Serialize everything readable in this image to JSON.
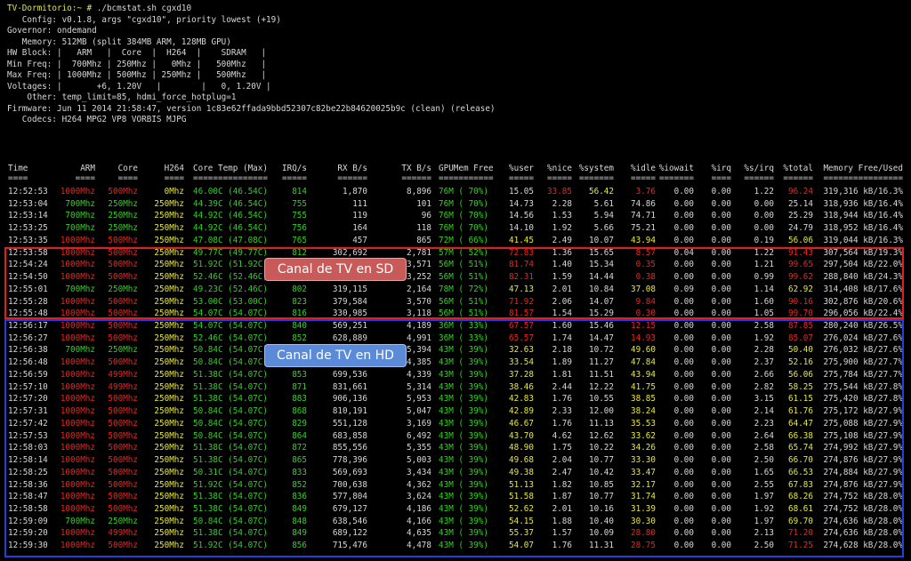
{
  "header": {
    "prompt": "TV-Dormitorio:~ #",
    "command": "./bcmstat.sh cgxd10",
    "lines": [
      "   Config: v0.1.8, args \"cgxd10\", priority lowest (+19)",
      "Governor: ondemand",
      "   Memory: 512MB (split 384MB ARM, 128MB GPU)",
      "HW Block: |   ARM   |  Core  |  H264  |    SDRAM   |",
      "Min Freq: |  700Mhz | 250Mhz |   0Mhz |   500Mhz   |",
      "Max Freq: | 1000Mhz | 500Mhz | 250Mhz |   500Mhz   |",
      "Voltages: |       +6, 1.20V   |        |   0, 1.20V |",
      "    Other: temp_limit=85, hdmi_force_hotplug=1",
      "Firmware: Jun 11 2014 21:58:47, version 1c83e62ffada9bbd52307c82be22b84620025b9c (clean) (release)",
      "   Codecs: H264 MPG2 VP8 VORBIS MJPG"
    ]
  },
  "table": {
    "columns": [
      "Time",
      "ARM",
      "Core",
      "H264",
      "Core Temp (Max)",
      "IRQ/s",
      "RX B/s",
      "TX B/s",
      "GPUMem Free",
      "%user",
      "%nice",
      "%system",
      "%idle",
      "%iowait",
      "%irq",
      "%s/irq",
      "%total",
      "Memory Free/Used"
    ],
    "rows": [
      [
        "12:52:53",
        "1000Mhz",
        "500Mhz",
        "0Mhz",
        "46.00C (46.54C)",
        "814",
        "1,870",
        "8,896",
        "76M ( 70%)",
        "15.05",
        "33.85",
        "56.42",
        "3.76",
        "0.00",
        "0.00",
        "1.22",
        "96.24",
        "319,316 kB/16.3%"
      ],
      [
        "12:53:04",
        "700Mhz",
        "250Mhz",
        "250Mhz",
        "44.39C (46.54C)",
        "755",
        "111",
        "101",
        "76M ( 70%)",
        "14.73",
        "2.28",
        "5.61",
        "74.86",
        "0.00",
        "0.00",
        "0.00",
        "25.14",
        "318,936 kB/16.4%"
      ],
      [
        "12:53:14",
        "700Mhz",
        "250Mhz",
        "250Mhz",
        "44.92C (46.54C)",
        "755",
        "119",
        "96",
        "76M ( 70%)",
        "14.56",
        "1.53",
        "5.94",
        "74.71",
        "0.00",
        "0.00",
        "0.00",
        "25.29",
        "318,944 kB/16.4%"
      ],
      [
        "12:53:25",
        "700Mhz",
        "250Mhz",
        "250Mhz",
        "44.92C (46.54C)",
        "756",
        "164",
        "118",
        "76M ( 70%)",
        "14.10",
        "1.92",
        "5.66",
        "75.21",
        "0.00",
        "0.00",
        "0.00",
        "24.79",
        "318,952 kB/16.4%"
      ],
      [
        "12:53:35",
        "1000Mhz",
        "500Mhz",
        "250Mhz",
        "47.08C (47.08C)",
        "765",
        "457",
        "865",
        "72M ( 66%)",
        "41.45",
        "2.49",
        "10.07",
        "43.94",
        "0.00",
        "0.00",
        "0.19",
        "56.06",
        "319,044 kB/16.3%"
      ],
      [
        "12:53:58",
        "1000Mhz",
        "500Mhz",
        "250Mhz",
        "49.77C (49.77C)",
        "812",
        "302,692",
        "2,781",
        "57M ( 52%)",
        "72.83",
        "1.36",
        "15.65",
        "8.57",
        "0.04",
        "0.00",
        "1.22",
        "91.43",
        "307,564 kB/19.3%"
      ],
      [
        "12:54:24",
        "1000Mhz",
        "500Mhz",
        "250Mhz",
        "51.92C (51.92C)",
        "823",
        "358,120",
        "3,571",
        "56M ( 51%)",
        "81.74",
        "1.40",
        "15.34",
        "0.35",
        "0.00",
        "0.00",
        "1.21",
        "99.65",
        "297,504 kB/22.0%"
      ],
      [
        "12:54:50",
        "1000Mhz",
        "500Mhz",
        "250Mhz",
        "52.46C (52.46C)",
        "830",
        "344,917",
        "3,252",
        "56M ( 51%)",
        "82.31",
        "1.59",
        "14.44",
        "0.38",
        "0.00",
        "0.00",
        "0.99",
        "99.62",
        "288,840 kB/24.3%"
      ],
      [
        "12:55:01",
        "700Mhz",
        "250Mhz",
        "250Mhz",
        "49.23C (52.46C)",
        "802",
        "319,115",
        "2,164",
        "78M ( 72%)",
        "47.13",
        "2.01",
        "10.84",
        "37.08",
        "0.09",
        "0.00",
        "1.14",
        "62.92",
        "314,408 kB/17.6%"
      ],
      [
        "12:55:28",
        "1000Mhz",
        "500Mhz",
        "250Mhz",
        "53.00C (53.00C)",
        "823",
        "379,584",
        "3,570",
        "56M ( 51%)",
        "71.92",
        "2.06",
        "14.07",
        "9.84",
        "0.00",
        "0.00",
        "1.60",
        "90.16",
        "302,876 kB/20.6%"
      ],
      [
        "12:55:48",
        "1000Mhz",
        "500Mhz",
        "250Mhz",
        "54.07C (54.07C)",
        "816",
        "330,985",
        "3,118",
        "56M ( 51%)",
        "81.57",
        "1.54",
        "15.29",
        "0.30",
        "0.00",
        "0.00",
        "1.05",
        "99.70",
        "296,056 kB/22.4%"
      ],
      [
        "12:56:17",
        "1000Mhz",
        "500Mhz",
        "250Mhz",
        "54.07C (54.07C)",
        "840",
        "569,251",
        "4,189",
        "36M ( 33%)",
        "67.57",
        "1.60",
        "15.46",
        "12.15",
        "0.00",
        "0.00",
        "2.58",
        "87.85",
        "280,240 kB/26.5%"
      ],
      [
        "12:56:27",
        "1000Mhz",
        "500Mhz",
        "250Mhz",
        "52.46C (54.07C)",
        "852",
        "628,889",
        "4,991",
        "36M ( 33%)",
        "65.57",
        "1.74",
        "14.47",
        "14.93",
        "0.00",
        "0.00",
        "1.92",
        "85.07",
        "276,024 kB/27.6%"
      ],
      [
        "12:56:38",
        "700Mhz",
        "250Mhz",
        "250Mhz",
        "50.84C (54.07C)",
        "834",
        "691,318",
        "5,394",
        "43M ( 39%)",
        "32.63",
        "2.18",
        "10.72",
        "49.60",
        "0.00",
        "0.00",
        "2.28",
        "50.40",
        "276,032 kB/27.6%"
      ],
      [
        "12:56:48",
        "1000Mhz",
        "500Mhz",
        "250Mhz",
        "50.84C (54.07C)",
        "834",
        "592,869",
        "4,385",
        "43M ( 39%)",
        "33.54",
        "1.89",
        "11.27",
        "47.84",
        "0.00",
        "0.00",
        "2.37",
        "52.16",
        "275,900 kB/27.7%"
      ],
      [
        "12:56:59",
        "1000Mhz",
        "499Mhz",
        "250Mhz",
        "51.38C (54.07C)",
        "853",
        "699,536",
        "4,339",
        "43M ( 39%)",
        "37.28",
        "1.81",
        "11.51",
        "43.94",
        "0.00",
        "0.00",
        "2.66",
        "56.06",
        "275,784 kB/27.7%"
      ],
      [
        "12:57:10",
        "1000Mhz",
        "499Mhz",
        "250Mhz",
        "51.38C (54.07C)",
        "871",
        "831,661",
        "5,314",
        "43M ( 39%)",
        "38.46",
        "2.44",
        "12.22",
        "41.75",
        "0.00",
        "0.00",
        "2.82",
        "58.25",
        "275,544 kB/27.8%"
      ],
      [
        "12:57:20",
        "1000Mhz",
        "500Mhz",
        "250Mhz",
        "51.38C (54.07C)",
        "883",
        "906,136",
        "5,953",
        "43M ( 39%)",
        "42.83",
        "1.76",
        "10.55",
        "38.85",
        "0.00",
        "0.00",
        "3.15",
        "61.15",
        "275,420 kB/27.8%"
      ],
      [
        "12:57:31",
        "1000Mhz",
        "500Mhz",
        "250Mhz",
        "50.84C (54.07C)",
        "868",
        "810,191",
        "5,047",
        "43M ( 39%)",
        "42.89",
        "2.33",
        "12.00",
        "38.24",
        "0.00",
        "0.00",
        "2.14",
        "61.76",
        "275,172 kB/27.9%"
      ],
      [
        "12:57:42",
        "1000Mhz",
        "500Mhz",
        "250Mhz",
        "50.84C (54.07C)",
        "829",
        "551,128",
        "3,169",
        "43M ( 39%)",
        "46.67",
        "1.76",
        "11.13",
        "35.53",
        "0.00",
        "0.00",
        "2.23",
        "64.47",
        "275,088 kB/27.9%"
      ],
      [
        "12:57:53",
        "1000Mhz",
        "500Mhz",
        "250Mhz",
        "50.84C (54.07C)",
        "864",
        "683,858",
        "6,492",
        "43M ( 39%)",
        "43.70",
        "4.62",
        "12.62",
        "33.62",
        "0.00",
        "0.00",
        "2.64",
        "66.38",
        "275,108 kB/27.9%"
      ],
      [
        "12:58:03",
        "1000Mhz",
        "500Mhz",
        "250Mhz",
        "51.38C (54.07C)",
        "872",
        "855,556",
        "5,355",
        "43M ( 39%)",
        "48.90",
        "1.75",
        "10.22",
        "34.26",
        "0.00",
        "0.00",
        "2.58",
        "65.74",
        "274,992 kB/27.9%"
      ],
      [
        "12:58:14",
        "1000Mhz",
        "500Mhz",
        "250Mhz",
        "51.38C (54.07C)",
        "865",
        "778,396",
        "5,003",
        "43M ( 39%)",
        "49.68",
        "2.04",
        "10.77",
        "33.30",
        "0.00",
        "0.00",
        "2.50",
        "66.70",
        "274,876 kB/27.9%"
      ],
      [
        "12:58:25",
        "1000Mhz",
        "500Mhz",
        "250Mhz",
        "50.31C (54.07C)",
        "833",
        "569,693",
        "3,434",
        "43M ( 39%)",
        "49.38",
        "2.47",
        "10.42",
        "33.47",
        "0.00",
        "0.00",
        "1.65",
        "66.53",
        "274,884 kB/27.9%"
      ],
      [
        "12:58:36",
        "1000Mhz",
        "500Mhz",
        "250Mhz",
        "51.92C (54.07C)",
        "852",
        "700,638",
        "4,362",
        "43M ( 39%)",
        "51.13",
        "1.82",
        "10.85",
        "32.17",
        "0.00",
        "0.00",
        "2.55",
        "67.83",
        "274,876 kB/27.9%"
      ],
      [
        "12:58:47",
        "1000Mhz",
        "500Mhz",
        "250Mhz",
        "51.38C (54.07C)",
        "836",
        "577,804",
        "3,624",
        "43M ( 39%)",
        "51.58",
        "1.87",
        "10.77",
        "31.74",
        "0.00",
        "0.00",
        "1.97",
        "68.26",
        "274,752 kB/28.0%"
      ],
      [
        "12:58:58",
        "1000Mhz",
        "500Mhz",
        "250Mhz",
        "51.38C (54.07C)",
        "849",
        "679,127",
        "4,186",
        "43M ( 39%)",
        "52.62",
        "2.01",
        "10.16",
        "31.39",
        "0.00",
        "0.00",
        "1.92",
        "68.61",
        "274,752 kB/28.0%"
      ],
      [
        "12:59:09",
        "700Mhz",
        "250Mhz",
        "250Mhz",
        "50.84C (54.07C)",
        "848",
        "638,546",
        "4,166",
        "43M ( 39%)",
        "54.15",
        "1.88",
        "10.40",
        "30.30",
        "0.00",
        "0.00",
        "1.97",
        "69.70",
        "274,636 kB/28.0%"
      ],
      [
        "12:59:20",
        "1000Mhz",
        "499Mhz",
        "250Mhz",
        "51.38C (54.07C)",
        "849",
        "689,122",
        "4,635",
        "43M ( 39%)",
        "55.37",
        "1.57",
        "10.09",
        "28.80",
        "0.00",
        "0.00",
        "2.13",
        "71.20",
        "274,636 kB/28.0%"
      ],
      [
        "12:59:30",
        "1000Mhz",
        "500Mhz",
        "250Mhz",
        "51.92C (54.07C)",
        "856",
        "715,476",
        "4,478",
        "43M ( 39%)",
        "54.07",
        "1.76",
        "11.31",
        "28.75",
        "0.00",
        "0.00",
        "2.50",
        "71.25",
        "274,628 kB/28.0%"
      ]
    ]
  },
  "annotations": {
    "sd_label": "Canal de TV en SD",
    "hd_label": "Canal de TV en HD"
  },
  "colors": {
    "red": "#e8261f",
    "green": "#34d024",
    "yellow": "#e8e83a",
    "white": "#d8d8d8",
    "sd_box": "#e02020",
    "hd_box": "#2040e0"
  }
}
